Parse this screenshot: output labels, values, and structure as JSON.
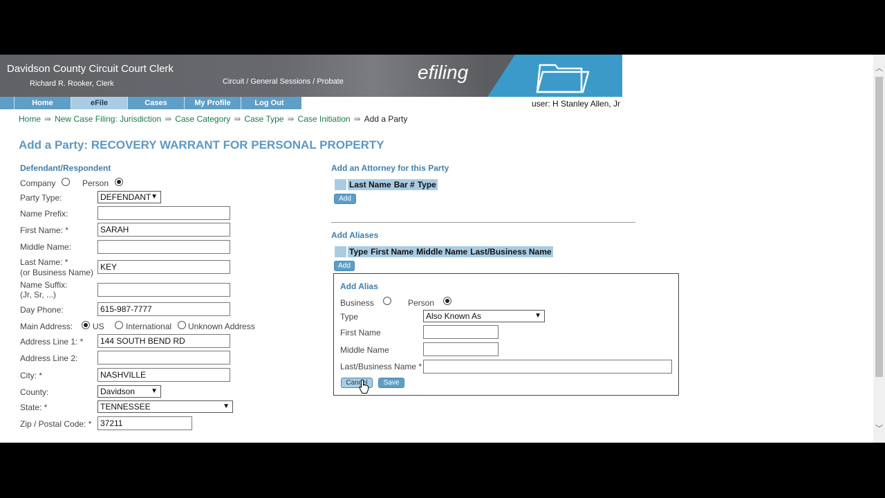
{
  "header": {
    "clerk_office": "Davidson County Circuit Court Clerk",
    "clerk_name": "Richard R. Rooker, Clerk",
    "courts": "Circuit / General Sessions / Probate",
    "brand": "efiling",
    "user": "user: H Stanley Allen, Jr"
  },
  "nav": [
    "Home",
    "eFile",
    "Cases",
    "My Profile",
    "Log Out"
  ],
  "breadcrumb": {
    "home": "Home",
    "jurisdiction": "New Case Filing: Jurisdiction",
    "category": "Case Category",
    "type": "Case Type",
    "initiation": "Case Initiation",
    "current": "Add a Party",
    "sep": "⇛"
  },
  "page_title": "Add a Party: RECOVERY WARRANT FOR PERSONAL PROPERTY",
  "party": {
    "section": "Defendant/Respondent",
    "company": "Company",
    "person": "Person",
    "party_type_label": "Party Type:",
    "party_type": "DEFENDANT",
    "prefix_label": "Name Prefix:",
    "prefix": "",
    "first_label": "First Name: *",
    "first": "SARAH",
    "middle_label": "Middle Name:",
    "middle": "",
    "last_label": "Last Name: *",
    "last_sub": "(or Business Name)",
    "last": "KEY",
    "suffix_label": "Name Suffix:",
    "suffix_sub": "(Jr, Sr, ...)",
    "suffix": "",
    "phone_label": "Day Phone:",
    "phone": "615-987-7777",
    "main_address_label": "Main Address:",
    "addr_us": "US",
    "addr_intl": "International",
    "addr_unknown": "Unknown Address",
    "line1_label": "Address Line 1: *",
    "line1": "144 SOUTH BEND RD",
    "line2_label": "Address Line 2:",
    "line2": "",
    "city_label": "City: *",
    "city": "NASHVILLE",
    "county_label": "County:",
    "county": "Davidson",
    "state_label": "State: *",
    "state": "TENNESSEE",
    "zip_label": "Zip / Postal Code: *",
    "zip": "37211"
  },
  "attorney": {
    "section": "Add an Attorney for this Party",
    "columns": [
      "Last Name",
      "Bar #",
      "Type"
    ],
    "add": "Add"
  },
  "aliases": {
    "section": "Add Aliases",
    "columns": [
      "Type",
      "First Name",
      "Middle Name",
      "Last/Business Name"
    ],
    "add": "Add"
  },
  "alias_form": {
    "title": "Add Alias",
    "business": "Business",
    "person": "Person",
    "type_label": "Type",
    "type": "Also Known As",
    "first_label": "First Name",
    "first": "",
    "middle_label": "Middle Name",
    "middle": "",
    "last_label": "Last/Business Name *",
    "last": "",
    "cancel": "Cancel",
    "save": "Save"
  }
}
